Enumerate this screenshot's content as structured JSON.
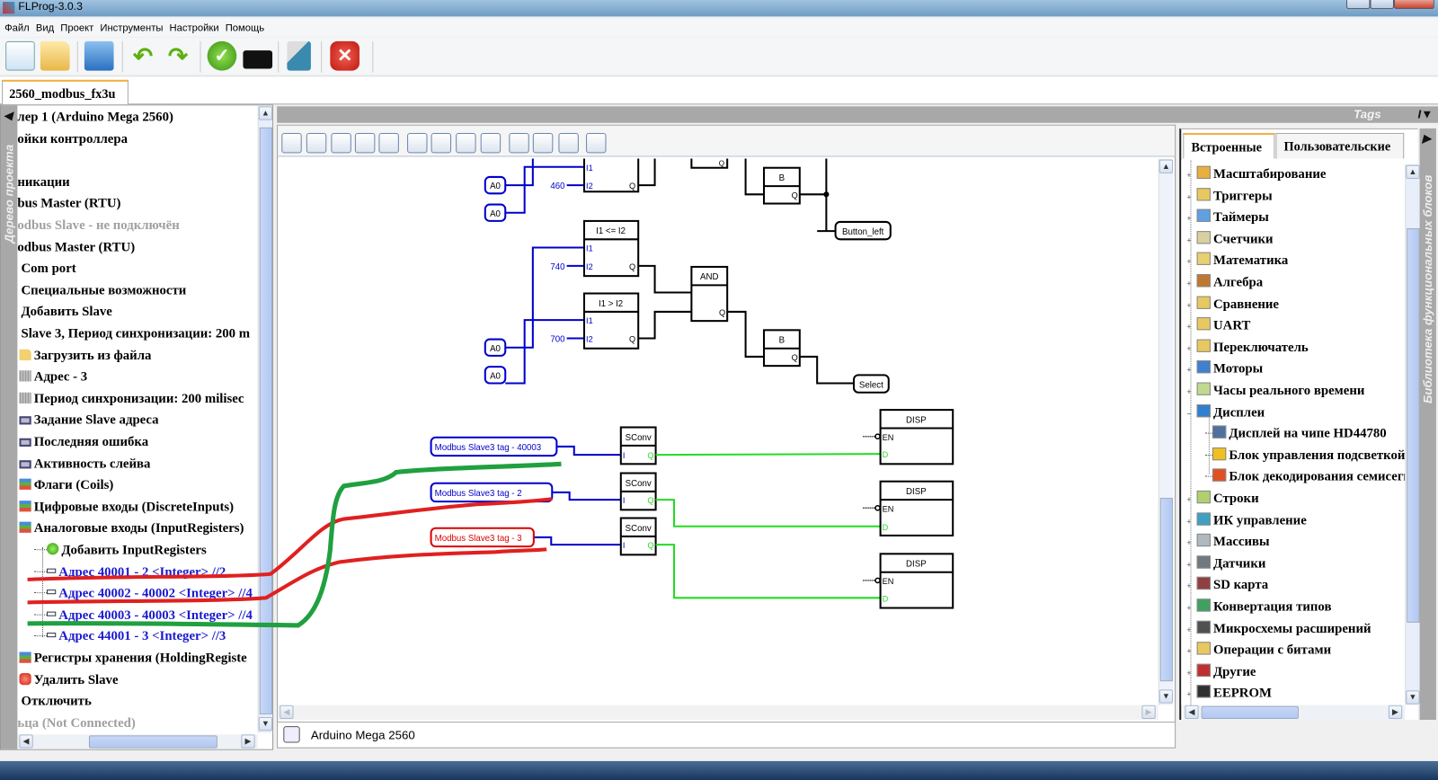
{
  "window": {
    "title": "FLProg-3.0.3"
  },
  "menu": [
    "Файл",
    "Вид",
    "Проект",
    "Инструменты",
    "Настройки",
    "Помощь"
  ],
  "toolbar": [
    {
      "icon": "new-file-icon"
    },
    {
      "icon": "open-folder-icon"
    },
    {
      "icon": "save-icon"
    },
    {
      "icon": "undo-icon"
    },
    {
      "icon": "redo-icon"
    },
    {
      "icon": "verify-icon"
    },
    {
      "icon": "upload-to-controller-icon"
    },
    {
      "icon": "monitor-icon"
    },
    {
      "icon": "stop-icon"
    }
  ],
  "document_tab": "2560_modbus_fx3u",
  "project_tree": {
    "panel_title": "Дерево проекта",
    "items": [
      {
        "label": "лер 1 (Arduino Mega 2560)",
        "indent": 0,
        "style": "normal",
        "icon": ""
      },
      {
        "label": "ойки контроллера",
        "indent": 0,
        "style": "normal",
        "icon": ""
      },
      {
        "label": "",
        "indent": 0,
        "style": "normal",
        "icon": ""
      },
      {
        "label": "никации",
        "indent": 0,
        "style": "normal",
        "icon": ""
      },
      {
        "label": "bus Master  (RTU)",
        "indent": 0,
        "style": "normal",
        "icon": ""
      },
      {
        "label": "odbus Slave  - не подключён",
        "indent": 0,
        "style": "dim",
        "icon": ""
      },
      {
        "label": "odbus Master  (RTU)",
        "indent": 0,
        "style": "normal",
        "icon": ""
      },
      {
        "label": "Com port",
        "indent": 1,
        "style": "normal",
        "icon": ""
      },
      {
        "label": "Специальные возможности",
        "indent": 1,
        "style": "normal",
        "icon": ""
      },
      {
        "label": "Добавить Slave",
        "indent": 1,
        "style": "normal",
        "icon": ""
      },
      {
        "label": "Slave 3, Период синхронизации: 200 m",
        "indent": 1,
        "style": "normal",
        "icon": ""
      },
      {
        "label": "Загрузить из файла",
        "indent": 2,
        "style": "normal",
        "icon": "folder-icon"
      },
      {
        "label": "Адрес - 3",
        "indent": 2,
        "style": "normal",
        "icon": "register-icon"
      },
      {
        "label": "Период синхронизации: 200 milisec",
        "indent": 2,
        "style": "normal",
        "icon": "register-icon"
      },
      {
        "label": "Задание Slave адреса",
        "indent": 2,
        "style": "normal",
        "icon": "pin-icon"
      },
      {
        "label": "Последняя ошибка",
        "indent": 2,
        "style": "normal",
        "icon": "pin-icon"
      },
      {
        "label": "Активность слейва",
        "indent": 2,
        "style": "normal",
        "icon": "pin-icon"
      },
      {
        "label": "Флаги (Coils)",
        "indent": 2,
        "style": "normal",
        "icon": "stack-icon"
      },
      {
        "label": "Цифровые входы (DiscreteInputs)",
        "indent": 2,
        "style": "normal",
        "icon": "stack-icon"
      },
      {
        "label": "Аналоговые входы (InputRegisters)",
        "indent": 2,
        "style": "normal",
        "icon": "stack-icon"
      },
      {
        "label": "Добавить InputRegisters",
        "indent": 3,
        "style": "normal",
        "icon": "add-icon"
      },
      {
        "label": "Адрес 40001 - 2 <Integer> //2",
        "indent": 3,
        "style": "blue",
        "icon": "tag-icon"
      },
      {
        "label": "Адрес 40002 - 40002 <Integer> //4",
        "indent": 3,
        "style": "blue",
        "icon": "tag-icon"
      },
      {
        "label": "Адрес 40003 - 40003 <Integer> //4",
        "indent": 3,
        "style": "blue",
        "icon": "tag-icon"
      },
      {
        "label": "Адрес 44001 - 3 <Integer> //3",
        "indent": 3,
        "style": "blue",
        "icon": "tag-icon"
      },
      {
        "label": "Регистры хранения (HoldingRegiste",
        "indent": 2,
        "style": "normal",
        "icon": "stack-icon"
      },
      {
        "label": "Удалить Slave",
        "indent": 2,
        "style": "normal",
        "icon": "delete-icon"
      },
      {
        "label": "Отключить",
        "indent": 1,
        "style": "normal",
        "icon": ""
      },
      {
        "label": "ьца (Not Connected)",
        "indent": 0,
        "style": "dim",
        "icon": ""
      }
    ]
  },
  "tags_bar": {
    "label": "Tags",
    "pin": "I▼"
  },
  "editor_toolbar": [
    "insert-block-icon",
    "insert-io-icon",
    "move-up-icon",
    "move-down-icon",
    "delete-board-icon",
    "copy-icon",
    "cut-icon",
    "paste-icon",
    "delete-icon",
    "board-left-icon",
    "board-remove-icon",
    "board-right-icon",
    "tree-icon"
  ],
  "diagram": {
    "inputs": [
      {
        "label": "A0"
      },
      {
        "label": "A0"
      },
      {
        "label": "A0"
      },
      {
        "label": "A0"
      }
    ],
    "constants": [
      "460",
      "740",
      "700"
    ],
    "blocks": {
      "cmp_top": {
        "pins": [
          "I1",
          "I2",
          "Q"
        ]
      },
      "cmp_le": {
        "title": "I1 <= I2",
        "pins": [
          "I1",
          "I2",
          "Q"
        ]
      },
      "cmp_gt": {
        "title": "I1 > I2",
        "pins": [
          "I1",
          "I2",
          "Q"
        ]
      },
      "and": {
        "title": "AND",
        "out": "Q"
      },
      "b_top": {
        "title": "B",
        "out": "Q"
      },
      "b_bottom": {
        "title": "B",
        "out": "Q"
      },
      "top_cut": {
        "out": "Q"
      }
    },
    "outputs": [
      "Button_left",
      "Select"
    ],
    "modbus_tags": [
      {
        "label": "Modbus Slave3 tag - 40003",
        "color": "#0000cc"
      },
      {
        "label": "Modbus Slave3 tag - 2",
        "color": "#0000cc"
      },
      {
        "label": "Modbus Slave3 tag - 3",
        "color": "#dd0000"
      }
    ],
    "sconv": {
      "title": "SConv",
      "in": "I",
      "out": "Q"
    },
    "disp": {
      "title": "DISP",
      "en": "EN",
      "d": "D"
    },
    "colors": {
      "analog_wire": "#0000cc",
      "logic_wire": "#000000",
      "string_wire": "#22dd22",
      "annotation_red": "#e02020",
      "annotation_green": "#20a040"
    }
  },
  "status": {
    "controller": "Arduino Mega 2560"
  },
  "library": {
    "panel_title": "Библиотека функциональных блоков",
    "tabs": [
      "Встроенные",
      "Пользовательские"
    ],
    "active_tab": "Встроенные",
    "items": [
      {
        "label": "Масштабирование",
        "child": false,
        "color": "#e8b040"
      },
      {
        "label": "Триггеры",
        "child": false,
        "color": "#e8c860"
      },
      {
        "label": "Таймеры",
        "child": false,
        "color": "#60a0e0"
      },
      {
        "label": "Счетчики",
        "child": false,
        "color": "#d8d0a0"
      },
      {
        "label": "Математика",
        "child": false,
        "color": "#e8d070"
      },
      {
        "label": "Алгебра",
        "child": false,
        "color": "#c07830"
      },
      {
        "label": "Сравнение",
        "child": false,
        "color": "#e8c860"
      },
      {
        "label": "UART",
        "child": false,
        "color": "#e8c860"
      },
      {
        "label": "Переключатель",
        "child": false,
        "color": "#e8c860"
      },
      {
        "label": "Моторы",
        "child": false,
        "color": "#4080d0"
      },
      {
        "label": "Часы реального времени",
        "child": false,
        "color": "#c0d890"
      },
      {
        "label": "Дисплеи",
        "child": false,
        "color": "#3080d0",
        "expanded": true
      },
      {
        "label": "Дисплей на чипе HD44780",
        "child": true,
        "color": "#5070a0"
      },
      {
        "label": "Блок управления подсветкой",
        "child": true,
        "color": "#f0c020"
      },
      {
        "label": "Блок декодирования семисегм",
        "child": true,
        "color": "#e05020"
      },
      {
        "label": "Строки",
        "child": false,
        "color": "#b0d070"
      },
      {
        "label": "ИК управление",
        "child": false,
        "color": "#40a0c0"
      },
      {
        "label": "Массивы",
        "child": false,
        "color": "#b0b8c0"
      },
      {
        "label": "Датчики",
        "child": false,
        "color": "#707880"
      },
      {
        "label": "SD карта",
        "child": false,
        "color": "#904040"
      },
      {
        "label": "Конвертация типов",
        "child": false,
        "color": "#40a060"
      },
      {
        "label": "Микросхемы расширений",
        "child": false,
        "color": "#505050"
      },
      {
        "label": "Операции с битами",
        "child": false,
        "color": "#e8c860"
      },
      {
        "label": "Другие",
        "child": false,
        "color": "#c03030"
      },
      {
        "label": "EEPROM",
        "child": false,
        "color": "#303030"
      }
    ]
  }
}
